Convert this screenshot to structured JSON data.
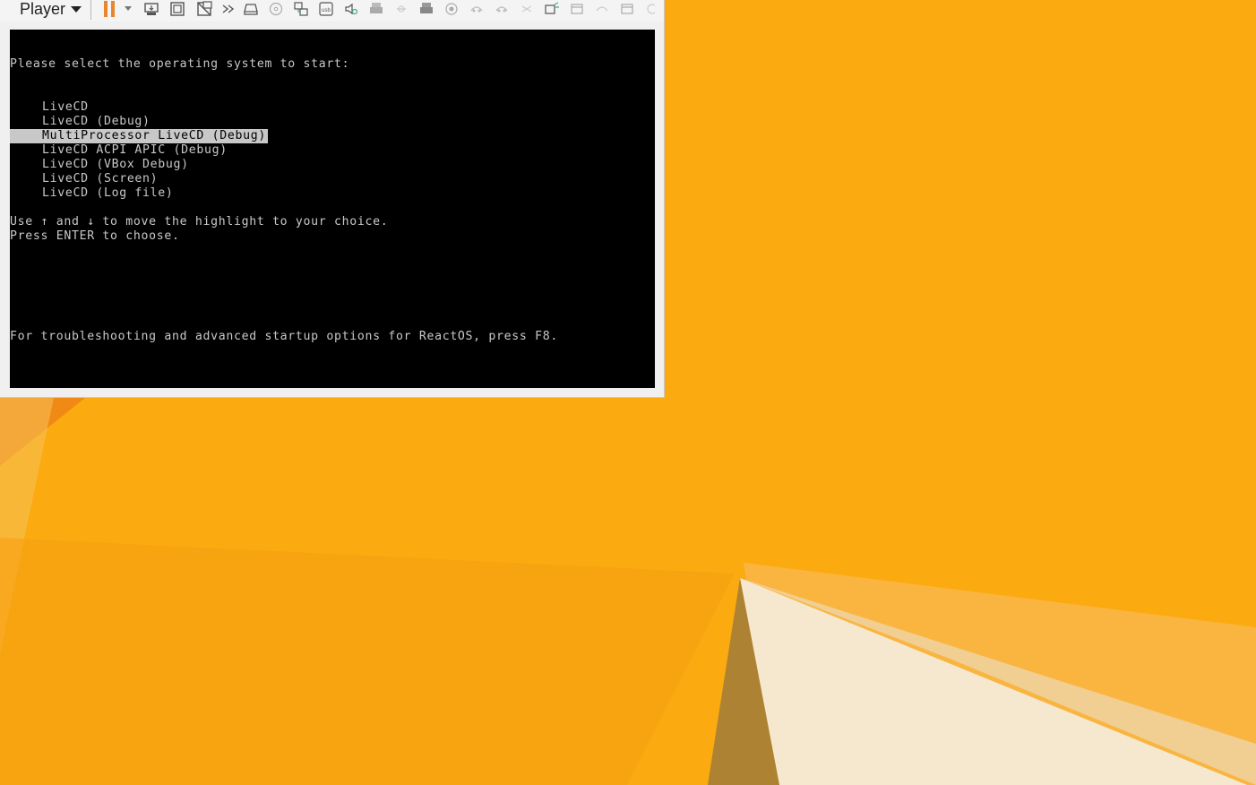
{
  "player": {
    "menu_label": "Player",
    "toolbar_icons": [
      "pause-icon",
      "send-ctrl-alt-del-icon",
      "full-screen-icon",
      "unity-icon",
      "forward-icon",
      "hard-disk-icon",
      "cd-dvd-icon",
      "network-adapter-icon",
      "usb-icon",
      "sound-card-icon",
      "printer-icon",
      "serial-port-icon",
      "floppy-icon",
      "camera-icon",
      "bluetooth-icon",
      "smart-card-icon",
      "messages-icon",
      "display-icon"
    ]
  },
  "console": {
    "prompt": "Please select the operating system to start:",
    "options": [
      "LiveCD",
      "LiveCD (Debug)",
      "MultiProcessor LiveCD (Debug)",
      "LiveCD ACPI APIC (Debug)",
      "LiveCD (VBox Debug)",
      "LiveCD (Screen)",
      "LiveCD (Log file)"
    ],
    "selected_index": 2,
    "instruction_1": "Use ↑ and ↓ to move the highlight to your choice.",
    "instruction_2": "Press ENTER to choose.",
    "footer": "For troubleshooting and advanced startup options for ReactOS, press F8."
  },
  "colors": {
    "desktop_background": "#fbab10",
    "console_background": "#000000",
    "console_text": "#c8c8c8",
    "pause_accent": "#e8862b"
  }
}
